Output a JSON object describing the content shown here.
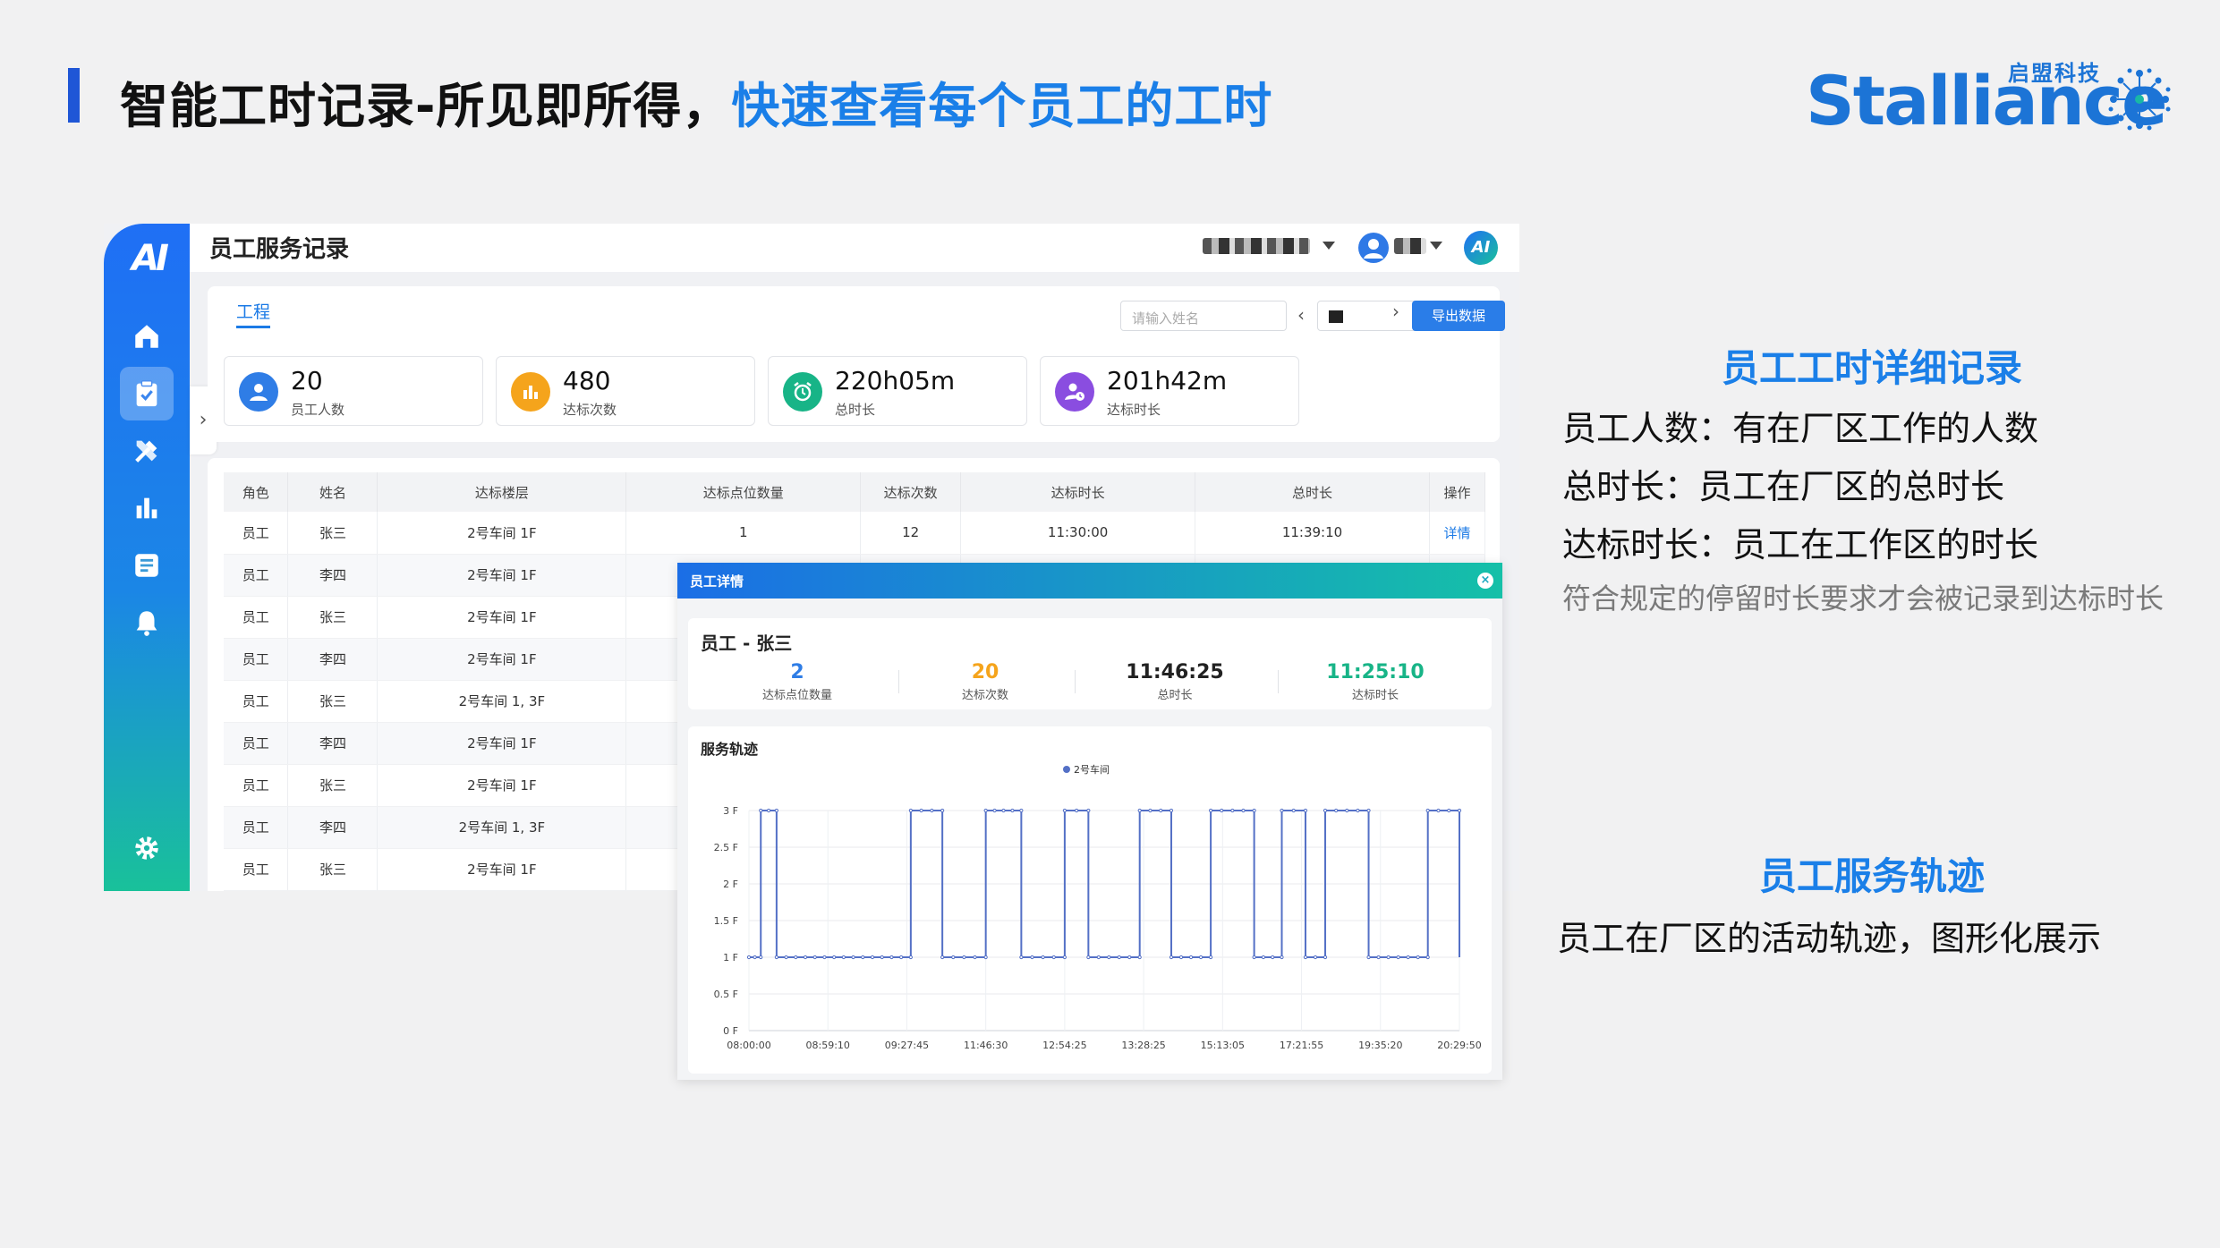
{
  "slide": {
    "title_main": "智能工时记录-所见即所得，",
    "title_highlight": "快速查看每个员工的工时",
    "brand": "Stalliance",
    "brand_cn": "启盟科技"
  },
  "app": {
    "logo": "AI",
    "title": "员工服务记录",
    "tab": "工程",
    "search_placeholder": "请输入姓名",
    "export_label": "导出数据",
    "stats": [
      {
        "value": "20",
        "label": "员工人数",
        "color": "#2f7de6"
      },
      {
        "value": "480",
        "label": "达标次数",
        "color": "#f5a41c"
      },
      {
        "value": "220h05m",
        "label": "总时长",
        "color": "#18b487"
      },
      {
        "value": "201h42m",
        "label": "达标时长",
        "color": "#8a4de0"
      }
    ],
    "table": {
      "headers": [
        "角色",
        "姓名",
        "达标楼层",
        "达标点位数量",
        "达标次数",
        "达标时长",
        "总时长",
        "操作"
      ],
      "rows": [
        [
          "员工",
          "张三",
          "2号车间 1F",
          "1",
          "12",
          "11:30:00",
          "11:39:10",
          "详情"
        ],
        [
          "员工",
          "李四",
          "2号车间 1F",
          "",
          "",
          "",
          "",
          ""
        ],
        [
          "员工",
          "张三",
          "2号车间 1F",
          "",
          "",
          "",
          "",
          ""
        ],
        [
          "员工",
          "李四",
          "2号车间 1F",
          "",
          "",
          "",
          "",
          ""
        ],
        [
          "员工",
          "张三",
          "2号车间 1, 3F",
          "",
          "",
          "",
          "",
          ""
        ],
        [
          "员工",
          "李四",
          "2号车间 1F",
          "",
          "",
          "",
          "",
          ""
        ],
        [
          "员工",
          "张三",
          "2号车间 1F",
          "",
          "",
          "",
          "",
          ""
        ],
        [
          "员工",
          "李四",
          "2号车间 1, 3F",
          "",
          "",
          "",
          "",
          ""
        ],
        [
          "员工",
          "张三",
          "2号车间 1F",
          "",
          "",
          "",
          "",
          ""
        ]
      ]
    }
  },
  "modal": {
    "title": "员工详情",
    "employee": "员工 - 张三",
    "stats": [
      {
        "value": "2",
        "label": "达标点位数量",
        "color": "#2f7de6"
      },
      {
        "value": "20",
        "label": "达标次数",
        "color": "#f5a41c"
      },
      {
        "value": "11:46:25",
        "label": "总时长",
        "color": "#222222"
      },
      {
        "value": "11:25:10",
        "label": "达标时长",
        "color": "#18b487"
      }
    ],
    "chart_title": "服务轨迹"
  },
  "chart_data": {
    "type": "line",
    "legend": [
      "2号车间"
    ],
    "legend_position": "top-center",
    "y_ticks": [
      "0 F",
      "0.5 F",
      "1 F",
      "1.5 F",
      "2 F",
      "2.5 F",
      "3 F"
    ],
    "ylim": [
      0,
      3
    ],
    "x_ticks": [
      "08:00:00",
      "08:59:10",
      "09:27:45",
      "11:46:30",
      "12:54:25",
      "13:28:25",
      "15:13:05",
      "17:21:55",
      "19:35:20",
      "20:29:50"
    ],
    "grid": true,
    "series": [
      {
        "name": "2号车间",
        "color": "#5470c6",
        "step_x": [
          0,
          0.15,
          0.35,
          2.05,
          2.45,
          3.0,
          3.45,
          4.0,
          4.3,
          4.95,
          5.35,
          5.85,
          6.4,
          6.75,
          7.05,
          7.3,
          7.85,
          8.6,
          9.0
        ],
        "step_y": [
          1,
          3,
          1,
          3,
          1,
          3,
          1,
          3,
          1,
          3,
          1,
          3,
          1,
          3,
          1,
          3,
          1,
          3,
          1
        ]
      }
    ]
  },
  "notes": {
    "detail_title": "员工工时详细记录",
    "line1": "员工人数：有在厂区工作的人数",
    "line2": "总时长：员工在厂区的总时长",
    "line3": "达标时长：员工在工作区的时长",
    "line4": "符合规定的停留时长要求才会被记录到达标时长",
    "track_title": "员工服务轨迹",
    "line5": "员工在厂区的活动轨迹，图形化展示"
  }
}
